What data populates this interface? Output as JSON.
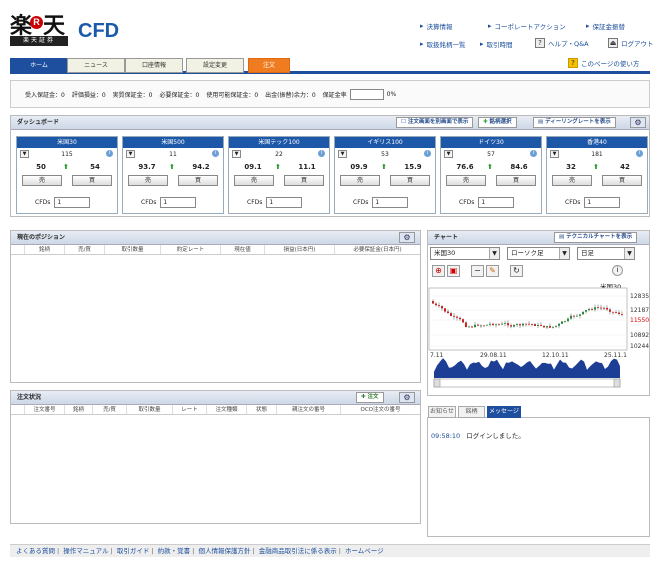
{
  "header": {
    "logo_kanji": "楽",
    "logo_r": "R",
    "logo_kanji2": "天",
    "logo_sub": "楽天証券",
    "app_title": "CFD",
    "links": [
      "決算情報",
      "コーポレートアクション",
      "保証金振替",
      "取扱銘柄一覧",
      "取引時間",
      "ヘルプ・Q&A",
      "ログアウト"
    ],
    "page_help": "このページの使い方"
  },
  "tabs": [
    "ホーム",
    "ニュース",
    "口座情報",
    "設定変更",
    "注文"
  ],
  "summary": {
    "items": [
      "受入保証金：0",
      "評価損益：0",
      "実質保証金：0",
      "必要保証金：0",
      "使用可能保証金：0",
      "出金(振替)余力：0",
      "保証金率"
    ],
    "rate": "0%"
  },
  "dashboard": {
    "title": "ダッシュボード",
    "btn_order_screen": "注文画面を別画面で表示",
    "btn_add_symbol": "銘柄選択",
    "btn_dealing": "ディーリングレートを表示",
    "sell_label": "売",
    "buy_label": "買",
    "cfd_label": "CFDs",
    "tiles": [
      {
        "name": "米国30",
        "qty": "115",
        "bid": "50",
        "ask": "54"
      },
      {
        "name": "米国500",
        "qty": "11",
        "bid": "93.7",
        "ask": "94.2"
      },
      {
        "name": "米国テック100",
        "qty": "22",
        "bid": "09.1",
        "ask": "11.1"
      },
      {
        "name": "イギリス100",
        "qty": "53",
        "bid": "09.9",
        "ask": "15.9"
      },
      {
        "name": "ドイツ30",
        "qty": "57",
        "bid": "76.6",
        "ask": "84.6"
      },
      {
        "name": "香港40",
        "qty": "181",
        "bid": "32",
        "ask": "42"
      }
    ],
    "cfd_value": "1"
  },
  "positions": {
    "title": "現在のポジション",
    "columns": [
      "銘柄",
      "売/買",
      "取引数量",
      "約定レート",
      "現在値",
      "損益(日本円)",
      "必要保証金(日本円)"
    ]
  },
  "orders": {
    "title": "注文状況",
    "btn_order": "注文",
    "columns": [
      "注文番号",
      "銘柄",
      "売/買",
      "取引数量",
      "レート",
      "注文種類",
      "状態",
      "親注文の番号",
      "OCO注文の番号"
    ]
  },
  "chart": {
    "title": "チャート",
    "btn_technical": "テクニカルチャートを表示",
    "symbol": "米国30",
    "type": "ローソク足",
    "period": "日足",
    "legend": "米国30",
    "price_labels": [
      "12835",
      "12187",
      "11550",
      "10892",
      "10244"
    ],
    "current_price": "11550",
    "date_labels": [
      "7.11",
      "29.08.11",
      "12.10.11",
      "25.11.1"
    ]
  },
  "messages": {
    "tabs": [
      "お知らせ",
      "銘柄",
      "メッセージ"
    ],
    "time": "09:58:10",
    "text": "ログインしました。"
  },
  "footer": [
    "よくある質問",
    "操作マニュアル",
    "取引ガイド",
    "約款・覚書",
    "個人情報保護方針",
    "金融商品取引法に係る表示",
    "ホームページ"
  ],
  "colors": {
    "brand": "#1d4f9e",
    "order_tab": "#f07c22",
    "price_up": "#2a9a2a"
  }
}
